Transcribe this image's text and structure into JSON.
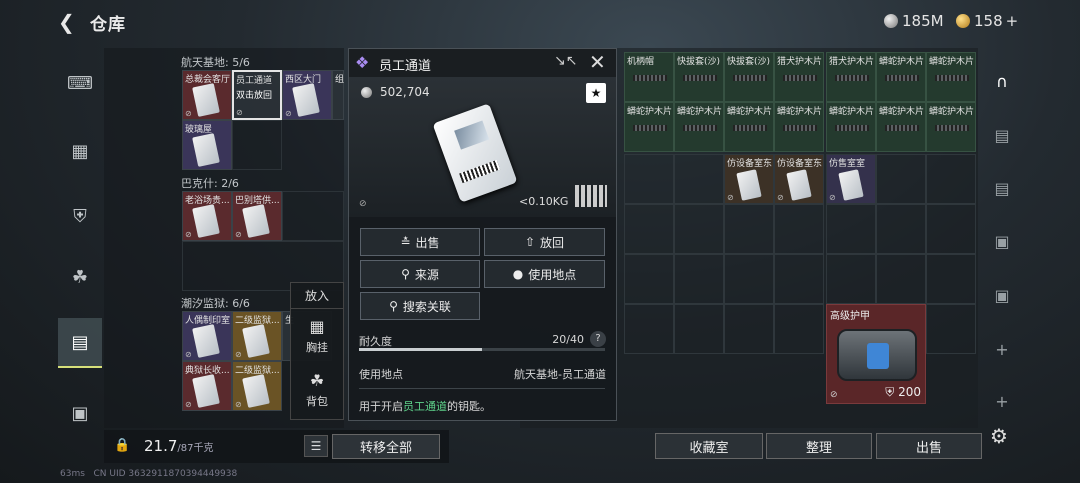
{
  "header": {
    "back_icon": "back-arrow-icon",
    "title": "仓库",
    "silver_amount": "185M",
    "gold_amount": "158",
    "gold_plus": "+"
  },
  "left_rail": {
    "items": [
      "gun-icon",
      "vest-icon",
      "armor-icon",
      "backpack-icon",
      "clipboard-icon",
      "briefcase-icon"
    ],
    "active_index": 4
  },
  "left_panel": {
    "sections": [
      {
        "label": "航天基地: 5/6",
        "slots": [
          "总裁会客厅",
          "员工通道",
          "西区大门",
          "组",
          "玻璃屋"
        ]
      },
      {
        "label": "巴克什: 2/6",
        "slots": [
          "老浴场贵...",
          "巴别塔供..."
        ]
      },
      {
        "label": "潮汐监狱: 6/6",
        "slots": [
          "人偶制印室",
          "二级监狱...",
          "生",
          "典狱长收...",
          "二级监狱..."
        ]
      }
    ],
    "selected_overlay": "双击放回"
  },
  "popup": {
    "header": "放入",
    "items": [
      {
        "label": "胸挂",
        "icon": "chest-rig-icon"
      },
      {
        "label": "背包",
        "icon": "backpack-icon"
      }
    ]
  },
  "bottom_left": {
    "weight_value": "21.7",
    "weight_max": "/87千克",
    "transfer_all": "转移全部"
  },
  "right_grid": {
    "row1": [
      "机柄帽",
      "快拔套(沙)",
      "快拔套(沙)",
      "猎犬护木片",
      "猎犬护木片",
      "蟒蛇护木片",
      "蟒蛇护木片"
    ],
    "row2": [
      "蟒蛇护木片",
      "蟒蛇护木片",
      "蟒蛇护木片",
      "蟒蛇护木片",
      "蟒蛇护木片",
      "蟒蛇护木片",
      "蟒蛇护木片"
    ],
    "row3": [
      "仿设备室东",
      "仿设备室东",
      "仿售室室"
    ],
    "armor_label": "高级护甲",
    "armor_value": "200",
    "buttons": [
      "收藏室",
      "整理",
      "出售"
    ]
  },
  "detail": {
    "title": "员工通道",
    "price": "502,704",
    "weight": "<0.10KG",
    "buttons": {
      "sell": "出售",
      "put_back": "放回",
      "source": "来源",
      "use_location": "使用地点",
      "search": "搜索关联"
    },
    "durability_label": "耐久度",
    "durability_value": "20/40",
    "durability_fraction": 0.5,
    "use_location_label": "使用地点",
    "use_location_value": "航天基地-员工通道",
    "desc_prefix": "用于开启",
    "desc_highlight": "员工通道",
    "desc_suffix": "的钥匙。"
  },
  "status": {
    "ping": "63ms",
    "uid": "CN UID 3632911870394449938"
  }
}
